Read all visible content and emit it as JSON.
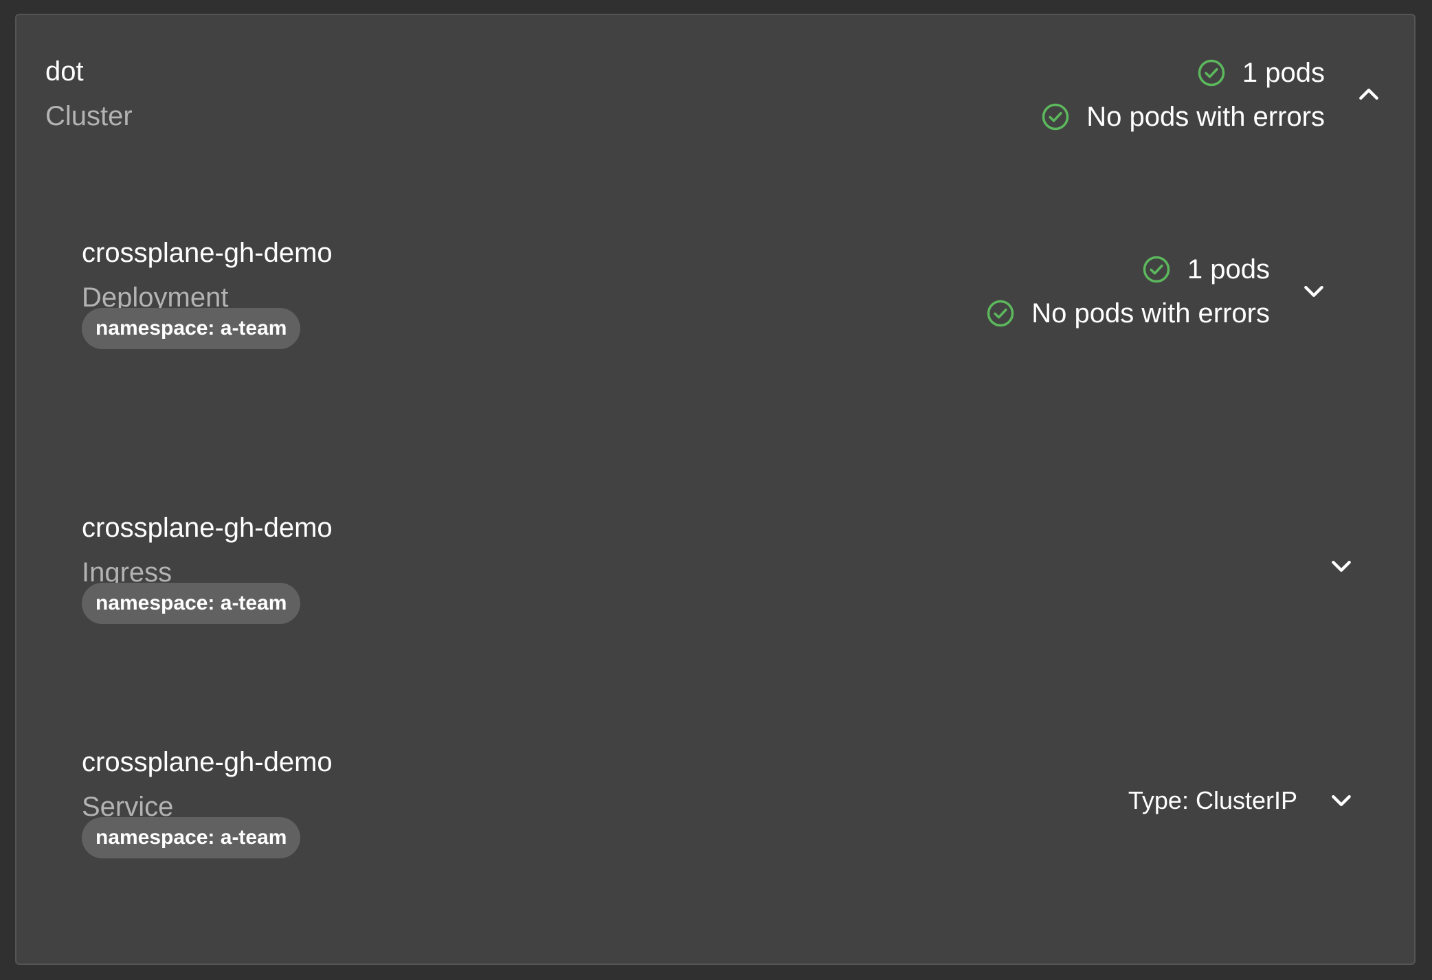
{
  "cluster": {
    "name": "dot",
    "kind": "Cluster",
    "status": {
      "pods": "1 pods",
      "errors": "No pods with errors"
    }
  },
  "resources": [
    {
      "name": "crossplane-gh-demo",
      "kind": "Deployment",
      "namespace": "namespace: a-team",
      "status": {
        "pods": "1 pods",
        "errors": "No pods with errors"
      }
    },
    {
      "name": "crossplane-gh-demo",
      "kind": "Ingress",
      "namespace": "namespace: a-team"
    },
    {
      "name": "crossplane-gh-demo",
      "kind": "Service",
      "namespace": "namespace: a-team",
      "type": "Type: ClusterIP"
    }
  ],
  "icons": {
    "status": "check-circle-icon",
    "expanded": "chevron-up-icon",
    "collapsed": "chevron-down-icon"
  },
  "colors": {
    "background": "#303030",
    "card": "#424242",
    "success": "#5cb85c",
    "chip": "#616161",
    "muted_text": "#b3b3b3"
  }
}
